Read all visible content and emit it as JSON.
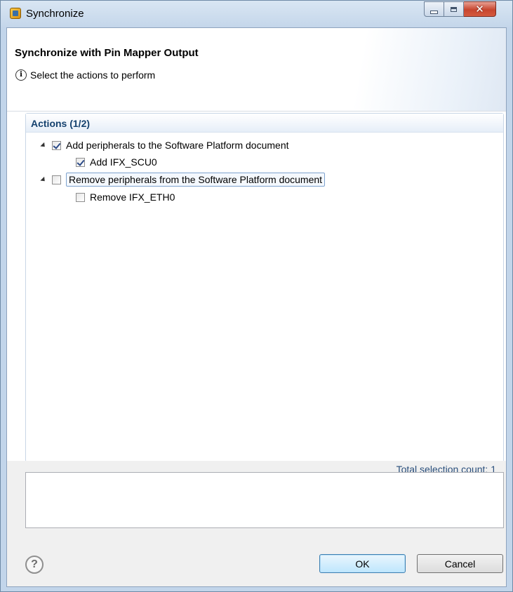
{
  "window": {
    "title": "Synchronize"
  },
  "header": {
    "title": "Synchronize with Pin Mapper Output",
    "subtitle": "Select the actions to perform"
  },
  "actions": {
    "title": "Actions (1/2)",
    "items": [
      {
        "label": "Add peripherals to the Software Platform document",
        "checked": true,
        "children": [
          {
            "label": "Add IFX_SCU0",
            "checked": true
          }
        ]
      },
      {
        "label": "Remove peripherals from the Software Platform document",
        "checked": false,
        "children": [
          {
            "label": "Remove IFX_ETH0",
            "checked": false
          }
        ]
      }
    ],
    "selection_count": "Total selection count: 1"
  },
  "message": {
    "text": ""
  },
  "buttons": {
    "ok": "OK",
    "cancel": "Cancel"
  },
  "icons": {
    "app": "app-icon",
    "info": "info-icon",
    "help": "help-icon"
  }
}
